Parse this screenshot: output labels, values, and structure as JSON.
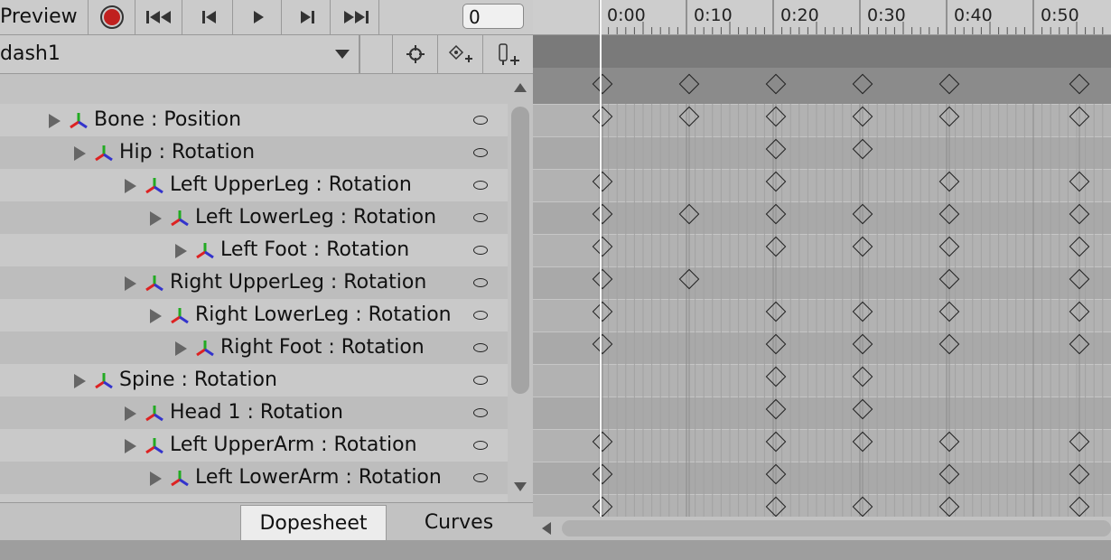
{
  "toolbar": {
    "preview_label": "Preview",
    "frame_value": "0"
  },
  "clip": {
    "name": "dash1"
  },
  "tree": [
    {
      "label": "Bone : Position",
      "indent": 0,
      "keys": [
        0,
        1,
        2,
        3,
        4,
        5.5
      ]
    },
    {
      "label": "Hip : Rotation",
      "indent": 1,
      "keys": [
        2,
        3
      ]
    },
    {
      "label": "Left UpperLeg : Rotation",
      "indent": 3,
      "keys": [
        0,
        2,
        4,
        5.5
      ]
    },
    {
      "label": "Left LowerLeg : Rotation",
      "indent": 4,
      "keys": [
        0,
        1,
        2,
        3,
        4,
        5.5
      ]
    },
    {
      "label": "Left Foot : Rotation",
      "indent": 5,
      "keys": [
        0,
        2,
        3,
        4,
        5.5
      ]
    },
    {
      "label": "Right UpperLeg : Rotation",
      "indent": 3,
      "keys": [
        0,
        1,
        4,
        5.5
      ]
    },
    {
      "label": "Right LowerLeg : Rotation",
      "indent": 4,
      "keys": [
        0,
        2,
        3,
        4,
        5.5
      ]
    },
    {
      "label": "Right Foot : Rotation",
      "indent": 5,
      "keys": [
        0,
        2,
        3,
        4,
        5.5
      ]
    },
    {
      "label": "Spine : Rotation",
      "indent": 1,
      "keys": [
        2,
        3
      ]
    },
    {
      "label": "Head 1 : Rotation",
      "indent": 3,
      "keys": [
        2,
        3
      ]
    },
    {
      "label": "Left UpperArm : Rotation",
      "indent": 3,
      "keys": [
        0,
        2,
        3,
        4,
        5.5
      ]
    },
    {
      "label": "Left LowerArm : Rotation",
      "indent": 4,
      "keys": [
        0,
        2,
        4,
        5.5
      ]
    },
    {
      "label": "",
      "indent": 4,
      "keys": [
        0,
        2,
        3,
        4,
        5.5
      ]
    }
  ],
  "summary_keys": [
    0,
    1,
    2,
    3,
    4,
    5.5
  ],
  "timeline": {
    "ticks": [
      "0:00",
      "0:10",
      "0:20",
      "0:30",
      "0:40",
      "0:50"
    ]
  },
  "tabs": {
    "dopesheet": "Dopesheet",
    "curves": "Curves"
  },
  "colors": {
    "record": "#c0201f",
    "bone_red": "#d22",
    "bone_green": "#2a2",
    "bone_blue": "#33c"
  }
}
